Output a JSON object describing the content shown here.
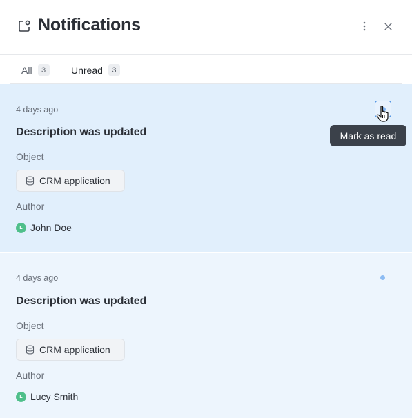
{
  "header": {
    "title": "Notifications",
    "icon": "notification-bell-icon",
    "more_icon": "more-vertical-icon",
    "close_icon": "close-icon"
  },
  "tabs": [
    {
      "label": "All",
      "count": "3"
    },
    {
      "label": "Unread",
      "count": "3",
      "active": true
    }
  ],
  "notifications": [
    {
      "time": "4 days ago",
      "title": "Description was updated",
      "object_label": "Object",
      "object_value": "CRM application",
      "author_label": "Author",
      "author_initial": "L",
      "author_name": "John Doe",
      "hovered": true
    },
    {
      "time": "4 days ago",
      "title": "Description was updated",
      "object_label": "Object",
      "object_value": "CRM application",
      "author_label": "Author",
      "author_initial": "L",
      "author_name": "Lucy Smith",
      "hovered": false
    }
  ],
  "tooltip": {
    "text": "Mark as read"
  },
  "colors": {
    "accent": "#4a90e2",
    "unread_bg": "#e1effc",
    "avatar": "#4fbf8a",
    "tooltip_bg": "#3b414a"
  }
}
